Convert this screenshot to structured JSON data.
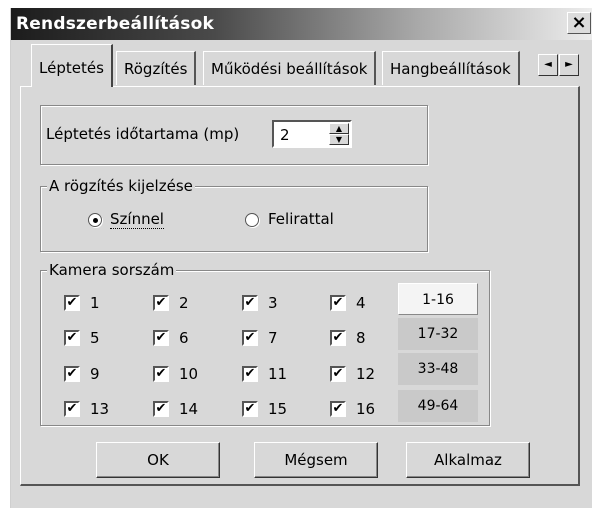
{
  "window": {
    "title": "Rendszerbeállítások",
    "close_label": "×"
  },
  "tabs": [
    {
      "label": "Léptetés",
      "active": true
    },
    {
      "label": "Rögzítés",
      "active": false
    },
    {
      "label": "Működési beállítások",
      "active": false
    },
    {
      "label": "Hangbeállítások",
      "active": false
    }
  ],
  "tab_scroll": {
    "left_icon": "◄",
    "right_icon": "►"
  },
  "step": {
    "label": "Léptetés időtartama (mp)",
    "value": "2",
    "spin_up_icon": "▲",
    "spin_down_icon": "▼"
  },
  "record_display": {
    "title": "A rögzítés kijelzése",
    "options": [
      {
        "label": "Színnel",
        "checked": true
      },
      {
        "label": "Felirattal",
        "checked": false
      }
    ]
  },
  "cameras": {
    "title": "Kamera sorszám",
    "checkbox_mark": "✔",
    "items": [
      "1",
      "2",
      "3",
      "4",
      "5",
      "6",
      "7",
      "8",
      "9",
      "10",
      "11",
      "12",
      "13",
      "14",
      "15",
      "16"
    ],
    "checked": [
      true,
      true,
      true,
      true,
      true,
      true,
      true,
      true,
      true,
      true,
      true,
      true,
      true,
      true,
      true,
      true
    ],
    "ranges": [
      "1-16",
      "17-32",
      "33-48",
      "49-64"
    ],
    "selected_range": "1-16"
  },
  "buttons": {
    "ok": "OK",
    "cancel": "Mégsem",
    "apply": "Alkalmaz"
  }
}
